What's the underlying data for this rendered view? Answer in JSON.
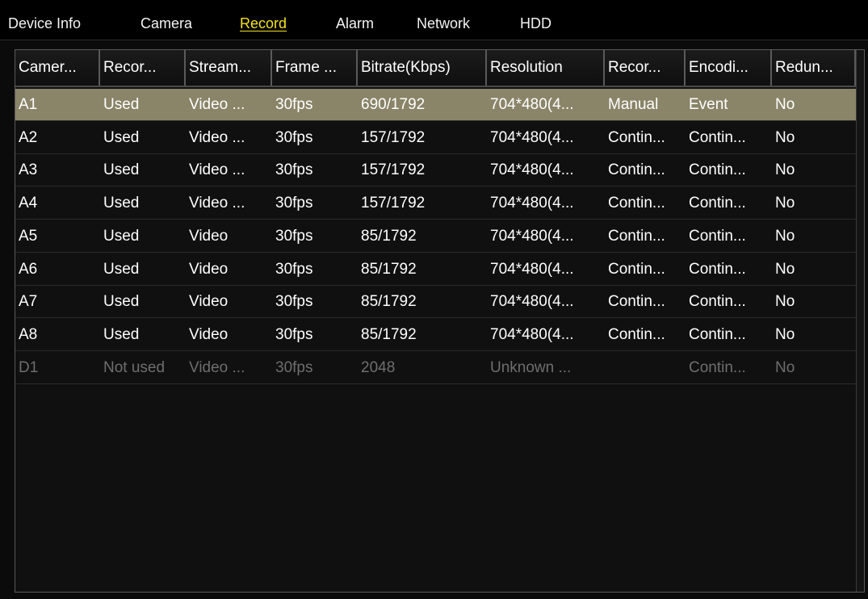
{
  "tabs": [
    {
      "label": "Device Info",
      "active": false
    },
    {
      "label": "Camera",
      "active": false
    },
    {
      "label": "Record",
      "active": true
    },
    {
      "label": "Alarm",
      "active": false
    },
    {
      "label": "Network",
      "active": false
    },
    {
      "label": "HDD",
      "active": false
    }
  ],
  "colors": {
    "active_tab": "#f4e21a",
    "selected_row": "#8a8468",
    "disabled_text": "#6e6e6e"
  },
  "table": {
    "headers": [
      "Camer...",
      "Recor...",
      "Stream...",
      "Frame ...",
      "Bitrate(Kbps)",
      "Resolution",
      "Recor...",
      "Encodi...",
      "Redun..."
    ],
    "rows": [
      {
        "cells": [
          "A1",
          "Used",
          "Video ...",
          "30fps",
          "690/1792",
          "704*480(4...",
          "Manual",
          "Event",
          "No"
        ],
        "selected": true,
        "disabled": false
      },
      {
        "cells": [
          "A2",
          "Used",
          "Video ...",
          "30fps",
          "157/1792",
          "704*480(4...",
          "Contin...",
          "Contin...",
          "No"
        ],
        "selected": false,
        "disabled": false
      },
      {
        "cells": [
          "A3",
          "Used",
          "Video ...",
          "30fps",
          "157/1792",
          "704*480(4...",
          "Contin...",
          "Contin...",
          "No"
        ],
        "selected": false,
        "disabled": false
      },
      {
        "cells": [
          "A4",
          "Used",
          "Video ...",
          "30fps",
          "157/1792",
          "704*480(4...",
          "Contin...",
          "Contin...",
          "No"
        ],
        "selected": false,
        "disabled": false
      },
      {
        "cells": [
          "A5",
          "Used",
          "Video",
          "30fps",
          "85/1792",
          "704*480(4...",
          "Contin...",
          "Contin...",
          "No"
        ],
        "selected": false,
        "disabled": false
      },
      {
        "cells": [
          "A6",
          "Used",
          "Video",
          "30fps",
          "85/1792",
          "704*480(4...",
          "Contin...",
          "Contin...",
          "No"
        ],
        "selected": false,
        "disabled": false
      },
      {
        "cells": [
          "A7",
          "Used",
          "Video",
          "30fps",
          "85/1792",
          "704*480(4...",
          "Contin...",
          "Contin...",
          "No"
        ],
        "selected": false,
        "disabled": false
      },
      {
        "cells": [
          "A8",
          "Used",
          "Video",
          "30fps",
          "85/1792",
          "704*480(4...",
          "Contin...",
          "Contin...",
          "No"
        ],
        "selected": false,
        "disabled": false
      },
      {
        "cells": [
          "D1",
          "Not used",
          "Video ...",
          "30fps",
          "2048",
          "Unknown ...",
          "",
          "Contin...",
          "No"
        ],
        "selected": false,
        "disabled": true
      }
    ]
  }
}
